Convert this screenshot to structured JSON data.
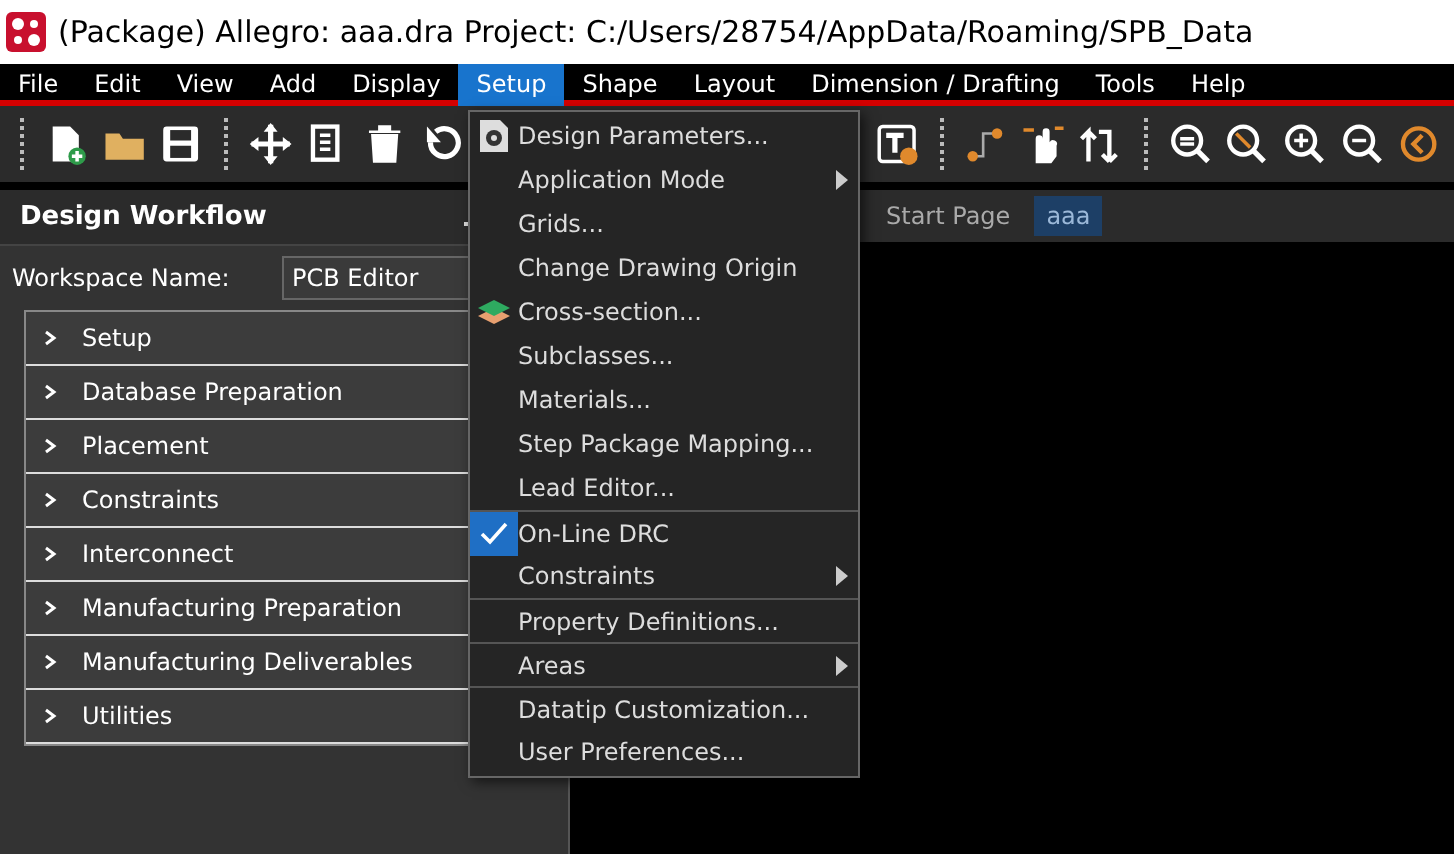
{
  "window": {
    "title": "(Package) Allegro: aaa.dra  Project: C:/Users/28754/AppData/Roaming/SPB_Data"
  },
  "menubar": [
    {
      "label": "File",
      "selected": false
    },
    {
      "label": "Edit",
      "selected": false
    },
    {
      "label": "View",
      "selected": false
    },
    {
      "label": "Add",
      "selected": false
    },
    {
      "label": "Display",
      "selected": false
    },
    {
      "label": "Setup",
      "selected": true
    },
    {
      "label": "Shape",
      "selected": false
    },
    {
      "label": "Layout",
      "selected": false
    },
    {
      "label": "Dimension / Drafting",
      "selected": false
    },
    {
      "label": "Tools",
      "selected": false
    },
    {
      "label": "Help",
      "selected": false
    }
  ],
  "workflow_panel": {
    "title": "Design Workflow",
    "workspace_label": "Workspace Name:",
    "workspace_value": "PCB Editor",
    "sections": [
      {
        "label": "Setup",
        "expanded": false
      },
      {
        "label": "Database Preparation",
        "expanded": false
      },
      {
        "label": "Placement",
        "expanded": false
      },
      {
        "label": "Constraints",
        "expanded": false
      },
      {
        "label": "Interconnect",
        "expanded": false
      },
      {
        "label": "Manufacturing Preparation",
        "expanded": false
      },
      {
        "label": "Manufacturing Deliverables",
        "expanded": false
      },
      {
        "label": "Utilities",
        "expanded": false
      }
    ]
  },
  "document_tabs": [
    {
      "label": "Start Page",
      "selected": false
    },
    {
      "label": "aaa",
      "selected": true
    }
  ],
  "setup_menu": [
    {
      "label": "Design Parameters...",
      "kind": "command",
      "separator_before": false
    },
    {
      "label": "Application Mode",
      "kind": "submenu",
      "separator_before": false
    },
    {
      "label": "Grids...",
      "kind": "command",
      "separator_before": false
    },
    {
      "label": "Change Drawing Origin",
      "kind": "command",
      "separator_before": false
    },
    {
      "label": "Cross-section...",
      "kind": "command",
      "separator_before": false
    },
    {
      "label": "Subclasses...",
      "kind": "command",
      "separator_before": false
    },
    {
      "label": "Materials...",
      "kind": "command",
      "separator_before": false
    },
    {
      "label": "Step Package Mapping...",
      "kind": "command",
      "separator_before": false
    },
    {
      "label": "Lead Editor...",
      "kind": "command",
      "separator_before": false
    },
    {
      "label": "On-Line DRC",
      "kind": "toggle",
      "checked": true,
      "separator_before": true
    },
    {
      "label": "Constraints",
      "kind": "submenu",
      "separator_before": false
    },
    {
      "label": "Property Definitions...",
      "kind": "command",
      "separator_before": true
    },
    {
      "label": "Areas",
      "kind": "submenu",
      "separator_before": true
    },
    {
      "label": "Datatip Customization...",
      "kind": "command",
      "separator_before": true
    },
    {
      "label": "User Preferences...",
      "kind": "command",
      "separator_before": false
    }
  ]
}
